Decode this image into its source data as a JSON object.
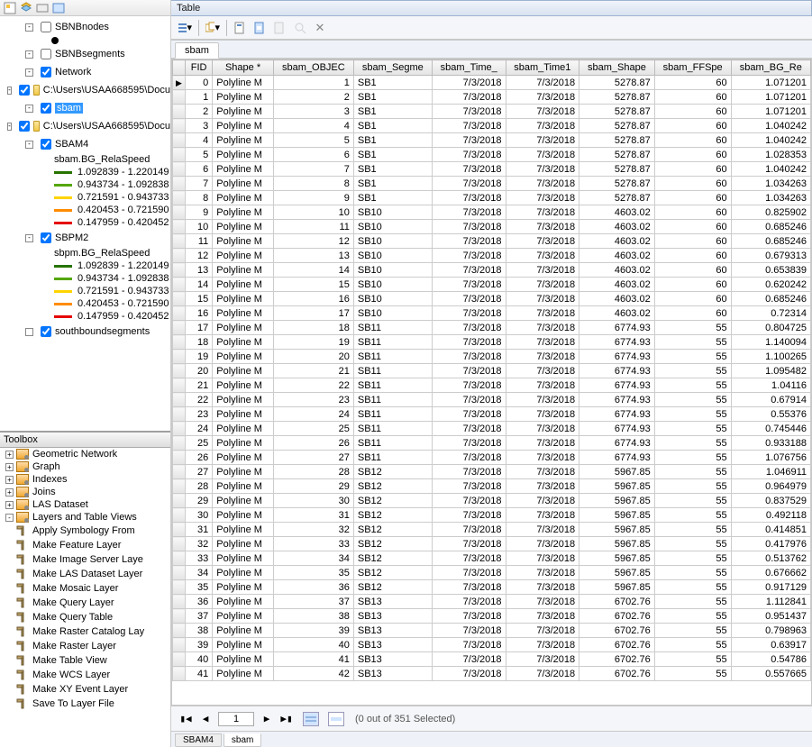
{
  "table_window": {
    "title": "Table"
  },
  "active_tab": "sbam",
  "bottom_tabs": [
    "SBAM4",
    "sbam"
  ],
  "status": {
    "page": 1,
    "text": "(0 out of 351 Selected)"
  },
  "toc": {
    "items": [
      {
        "type": "layer",
        "indent": 1,
        "exp": "-",
        "chk": false,
        "label": "SBNBnodes"
      },
      {
        "type": "sym-point",
        "indent": 2
      },
      {
        "type": "layer",
        "indent": 1,
        "exp": "-",
        "chk": false,
        "label": "SBNBsegments"
      },
      {
        "type": "layer",
        "indent": 1,
        "exp": "-",
        "chk": true,
        "label": "Network"
      },
      {
        "type": "folder",
        "indent": 0,
        "exp": "-",
        "chk": true,
        "label": "C:\\Users\\USAA668595\\Docu"
      },
      {
        "type": "layer",
        "indent": 1,
        "exp": "-",
        "chk": true,
        "label": "sbam",
        "selected": true
      },
      {
        "type": "folder",
        "indent": 0,
        "exp": "-",
        "chk": true,
        "label": "C:\\Users\\USAA668595\\Docu"
      },
      {
        "type": "layer",
        "indent": 1,
        "exp": "-",
        "chk": true,
        "label": "SBAM4"
      },
      {
        "type": "heading",
        "indent": 3,
        "label": "sbam.BG_RelaSpeed"
      },
      {
        "type": "swatch",
        "indent": 3,
        "cls": "g1",
        "label": "1.092839 - 1.220149"
      },
      {
        "type": "swatch",
        "indent": 3,
        "cls": "g2",
        "label": "0.943734 - 1.092838"
      },
      {
        "type": "swatch",
        "indent": 3,
        "cls": "g3",
        "label": "0.721591 - 0.943733"
      },
      {
        "type": "swatch",
        "indent": 3,
        "cls": "g4",
        "label": "0.420453 - 0.721590"
      },
      {
        "type": "swatch",
        "indent": 3,
        "cls": "g5",
        "label": "0.147959 - 0.420452"
      },
      {
        "type": "layer",
        "indent": 1,
        "exp": "-",
        "chk": true,
        "label": "SBPM2"
      },
      {
        "type": "heading",
        "indent": 3,
        "label": "sbpm.BG_RelaSpeed"
      },
      {
        "type": "swatch",
        "indent": 3,
        "cls": "g1",
        "label": "1.092839 - 1.220149"
      },
      {
        "type": "swatch",
        "indent": 3,
        "cls": "g2",
        "label": "0.943734 - 1.092838"
      },
      {
        "type": "swatch",
        "indent": 3,
        "cls": "g3",
        "label": "0.721591 - 0.943733"
      },
      {
        "type": "swatch",
        "indent": 3,
        "cls": "g4",
        "label": "0.420453 - 0.721590"
      },
      {
        "type": "swatch",
        "indent": 3,
        "cls": "g5",
        "label": "0.147959 - 0.420452"
      },
      {
        "type": "layer-trunc",
        "indent": 1,
        "exp": " ",
        "chk": true,
        "label": "southboundsegments"
      }
    ]
  },
  "toolbox": {
    "title": "Toolbox",
    "sets": [
      "Geometric Network",
      "Graph",
      "Indexes",
      "Joins",
      "LAS Dataset",
      "Layers and Table Views"
    ],
    "tools": [
      "Apply Symbology From",
      "Make Feature Layer",
      "Make Image Server Laye",
      "Make LAS Dataset Layer",
      "Make Mosaic Layer",
      "Make Query Layer",
      "Make Query Table",
      "Make Raster Catalog Lay",
      "Make Raster Layer",
      "Make Table View",
      "Make WCS Layer",
      "Make XY Event Layer",
      "Save To Layer File"
    ]
  },
  "columns": [
    "",
    "FID",
    "Shape *",
    "sbam_OBJEC",
    "sbam_Segme",
    "sbam_Time_",
    "sbam_Time1",
    "sbam_Shape",
    "sbam_FFSpe",
    "sbam_BG_Re"
  ],
  "rows": [
    {
      "fid": 0,
      "shape": "Polyline M",
      "objec": 1,
      "seg": "SB1",
      "t0": "7/3/2018",
      "t1": "7/3/2018",
      "shapef": 5278.87,
      "ff": 60,
      "bg": 1.071201
    },
    {
      "fid": 1,
      "shape": "Polyline M",
      "objec": 2,
      "seg": "SB1",
      "t0": "7/3/2018",
      "t1": "7/3/2018",
      "shapef": 5278.87,
      "ff": 60,
      "bg": 1.071201
    },
    {
      "fid": 2,
      "shape": "Polyline M",
      "objec": 3,
      "seg": "SB1",
      "t0": "7/3/2018",
      "t1": "7/3/2018",
      "shapef": 5278.87,
      "ff": 60,
      "bg": 1.071201
    },
    {
      "fid": 3,
      "shape": "Polyline M",
      "objec": 4,
      "seg": "SB1",
      "t0": "7/3/2018",
      "t1": "7/3/2018",
      "shapef": 5278.87,
      "ff": 60,
      "bg": 1.040242
    },
    {
      "fid": 4,
      "shape": "Polyline M",
      "objec": 5,
      "seg": "SB1",
      "t0": "7/3/2018",
      "t1": "7/3/2018",
      "shapef": 5278.87,
      "ff": 60,
      "bg": 1.040242
    },
    {
      "fid": 5,
      "shape": "Polyline M",
      "objec": 6,
      "seg": "SB1",
      "t0": "7/3/2018",
      "t1": "7/3/2018",
      "shapef": 5278.87,
      "ff": 60,
      "bg": 1.028353
    },
    {
      "fid": 6,
      "shape": "Polyline M",
      "objec": 7,
      "seg": "SB1",
      "t0": "7/3/2018",
      "t1": "7/3/2018",
      "shapef": 5278.87,
      "ff": 60,
      "bg": 1.040242
    },
    {
      "fid": 7,
      "shape": "Polyline M",
      "objec": 8,
      "seg": "SB1",
      "t0": "7/3/2018",
      "t1": "7/3/2018",
      "shapef": 5278.87,
      "ff": 60,
      "bg": 1.034263
    },
    {
      "fid": 8,
      "shape": "Polyline M",
      "objec": 9,
      "seg": "SB1",
      "t0": "7/3/2018",
      "t1": "7/3/2018",
      "shapef": 5278.87,
      "ff": 60,
      "bg": 1.034263
    },
    {
      "fid": 9,
      "shape": "Polyline M",
      "objec": 10,
      "seg": "SB10",
      "t0": "7/3/2018",
      "t1": "7/3/2018",
      "shapef": 4603.02,
      "ff": 60,
      "bg": 0.825902
    },
    {
      "fid": 10,
      "shape": "Polyline M",
      "objec": 11,
      "seg": "SB10",
      "t0": "7/3/2018",
      "t1": "7/3/2018",
      "shapef": 4603.02,
      "ff": 60,
      "bg": 0.685246
    },
    {
      "fid": 11,
      "shape": "Polyline M",
      "objec": 12,
      "seg": "SB10",
      "t0": "7/3/2018",
      "t1": "7/3/2018",
      "shapef": 4603.02,
      "ff": 60,
      "bg": 0.685246
    },
    {
      "fid": 12,
      "shape": "Polyline M",
      "objec": 13,
      "seg": "SB10",
      "t0": "7/3/2018",
      "t1": "7/3/2018",
      "shapef": 4603.02,
      "ff": 60,
      "bg": 0.679313
    },
    {
      "fid": 13,
      "shape": "Polyline M",
      "objec": 14,
      "seg": "SB10",
      "t0": "7/3/2018",
      "t1": "7/3/2018",
      "shapef": 4603.02,
      "ff": 60,
      "bg": 0.653839
    },
    {
      "fid": 14,
      "shape": "Polyline M",
      "objec": 15,
      "seg": "SB10",
      "t0": "7/3/2018",
      "t1": "7/3/2018",
      "shapef": 4603.02,
      "ff": 60,
      "bg": 0.620242
    },
    {
      "fid": 15,
      "shape": "Polyline M",
      "objec": 16,
      "seg": "SB10",
      "t0": "7/3/2018",
      "t1": "7/3/2018",
      "shapef": 4603.02,
      "ff": 60,
      "bg": 0.685246
    },
    {
      "fid": 16,
      "shape": "Polyline M",
      "objec": 17,
      "seg": "SB10",
      "t0": "7/3/2018",
      "t1": "7/3/2018",
      "shapef": 4603.02,
      "ff": 60,
      "bg": 0.72314
    },
    {
      "fid": 17,
      "shape": "Polyline M",
      "objec": 18,
      "seg": "SB11",
      "t0": "7/3/2018",
      "t1": "7/3/2018",
      "shapef": 6774.93,
      "ff": 55,
      "bg": 0.804725
    },
    {
      "fid": 18,
      "shape": "Polyline M",
      "objec": 19,
      "seg": "SB11",
      "t0": "7/3/2018",
      "t1": "7/3/2018",
      "shapef": 6774.93,
      "ff": 55,
      "bg": 1.140094
    },
    {
      "fid": 19,
      "shape": "Polyline M",
      "objec": 20,
      "seg": "SB11",
      "t0": "7/3/2018",
      "t1": "7/3/2018",
      "shapef": 6774.93,
      "ff": 55,
      "bg": 1.100265
    },
    {
      "fid": 20,
      "shape": "Polyline M",
      "objec": 21,
      "seg": "SB11",
      "t0": "7/3/2018",
      "t1": "7/3/2018",
      "shapef": 6774.93,
      "ff": 55,
      "bg": 1.095482
    },
    {
      "fid": 21,
      "shape": "Polyline M",
      "objec": 22,
      "seg": "SB11",
      "t0": "7/3/2018",
      "t1": "7/3/2018",
      "shapef": 6774.93,
      "ff": 55,
      "bg": 1.04116
    },
    {
      "fid": 22,
      "shape": "Polyline M",
      "objec": 23,
      "seg": "SB11",
      "t0": "7/3/2018",
      "t1": "7/3/2018",
      "shapef": 6774.93,
      "ff": 55,
      "bg": 0.67914
    },
    {
      "fid": 23,
      "shape": "Polyline M",
      "objec": 24,
      "seg": "SB11",
      "t0": "7/3/2018",
      "t1": "7/3/2018",
      "shapef": 6774.93,
      "ff": 55,
      "bg": 0.55376
    },
    {
      "fid": 24,
      "shape": "Polyline M",
      "objec": 25,
      "seg": "SB11",
      "t0": "7/3/2018",
      "t1": "7/3/2018",
      "shapef": 6774.93,
      "ff": 55,
      "bg": 0.745446
    },
    {
      "fid": 25,
      "shape": "Polyline M",
      "objec": 26,
      "seg": "SB11",
      "t0": "7/3/2018",
      "t1": "7/3/2018",
      "shapef": 6774.93,
      "ff": 55,
      "bg": 0.933188
    },
    {
      "fid": 26,
      "shape": "Polyline M",
      "objec": 27,
      "seg": "SB11",
      "t0": "7/3/2018",
      "t1": "7/3/2018",
      "shapef": 6774.93,
      "ff": 55,
      "bg": 1.076756
    },
    {
      "fid": 27,
      "shape": "Polyline M",
      "objec": 28,
      "seg": "SB12",
      "t0": "7/3/2018",
      "t1": "7/3/2018",
      "shapef": 5967.85,
      "ff": 55,
      "bg": 1.046911
    },
    {
      "fid": 28,
      "shape": "Polyline M",
      "objec": 29,
      "seg": "SB12",
      "t0": "7/3/2018",
      "t1": "7/3/2018",
      "shapef": 5967.85,
      "ff": 55,
      "bg": 0.964979
    },
    {
      "fid": 29,
      "shape": "Polyline M",
      "objec": 30,
      "seg": "SB12",
      "t0": "7/3/2018",
      "t1": "7/3/2018",
      "shapef": 5967.85,
      "ff": 55,
      "bg": 0.837529
    },
    {
      "fid": 30,
      "shape": "Polyline M",
      "objec": 31,
      "seg": "SB12",
      "t0": "7/3/2018",
      "t1": "7/3/2018",
      "shapef": 5967.85,
      "ff": 55,
      "bg": 0.492118
    },
    {
      "fid": 31,
      "shape": "Polyline M",
      "objec": 32,
      "seg": "SB12",
      "t0": "7/3/2018",
      "t1": "7/3/2018",
      "shapef": 5967.85,
      "ff": 55,
      "bg": 0.414851
    },
    {
      "fid": 32,
      "shape": "Polyline M",
      "objec": 33,
      "seg": "SB12",
      "t0": "7/3/2018",
      "t1": "7/3/2018",
      "shapef": 5967.85,
      "ff": 55,
      "bg": 0.417976
    },
    {
      "fid": 33,
      "shape": "Polyline M",
      "objec": 34,
      "seg": "SB12",
      "t0": "7/3/2018",
      "t1": "7/3/2018",
      "shapef": 5967.85,
      "ff": 55,
      "bg": 0.513762
    },
    {
      "fid": 34,
      "shape": "Polyline M",
      "objec": 35,
      "seg": "SB12",
      "t0": "7/3/2018",
      "t1": "7/3/2018",
      "shapef": 5967.85,
      "ff": 55,
      "bg": 0.676662
    },
    {
      "fid": 35,
      "shape": "Polyline M",
      "objec": 36,
      "seg": "SB12",
      "t0": "7/3/2018",
      "t1": "7/3/2018",
      "shapef": 5967.85,
      "ff": 55,
      "bg": 0.917129
    },
    {
      "fid": 36,
      "shape": "Polyline M",
      "objec": 37,
      "seg": "SB13",
      "t0": "7/3/2018",
      "t1": "7/3/2018",
      "shapef": 6702.76,
      "ff": 55,
      "bg": 1.112841
    },
    {
      "fid": 37,
      "shape": "Polyline M",
      "objec": 38,
      "seg": "SB13",
      "t0": "7/3/2018",
      "t1": "7/3/2018",
      "shapef": 6702.76,
      "ff": 55,
      "bg": 0.951437
    },
    {
      "fid": 38,
      "shape": "Polyline M",
      "objec": 39,
      "seg": "SB13",
      "t0": "7/3/2018",
      "t1": "7/3/2018",
      "shapef": 6702.76,
      "ff": 55,
      "bg": 0.798963
    },
    {
      "fid": 39,
      "shape": "Polyline M",
      "objec": 40,
      "seg": "SB13",
      "t0": "7/3/2018",
      "t1": "7/3/2018",
      "shapef": 6702.76,
      "ff": 55,
      "bg": 0.63917
    },
    {
      "fid": 40,
      "shape": "Polyline M",
      "objec": 41,
      "seg": "SB13",
      "t0": "7/3/2018",
      "t1": "7/3/2018",
      "shapef": 6702.76,
      "ff": 55,
      "bg": 0.54786
    },
    {
      "fid": 41,
      "shape": "Polyline M",
      "objec": 42,
      "seg": "SB13",
      "t0": "7/3/2018",
      "t1": "7/3/2018",
      "shapef": 6702.76,
      "ff": 55,
      "bg": 0.557665
    }
  ]
}
